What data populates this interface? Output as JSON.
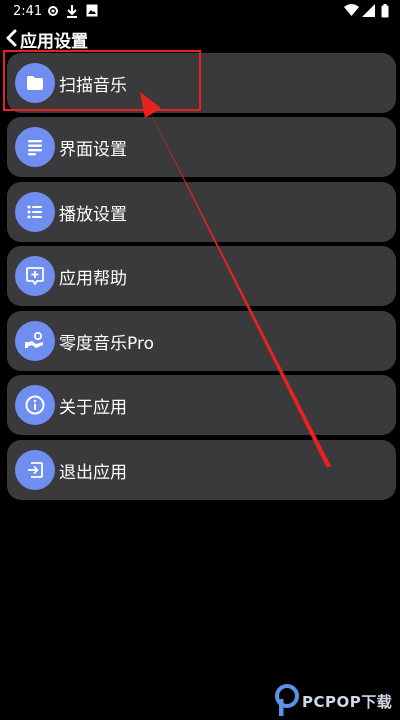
{
  "status_bar": {
    "time": "2:41",
    "icons": [
      "gear-icon",
      "download-icon",
      "image-icon",
      "wifi-icon",
      "signal-icon",
      "battery-icon"
    ]
  },
  "header": {
    "back_icon": "chevron-left-icon",
    "title": "应用设置"
  },
  "menu": {
    "items": [
      {
        "label": "扫描音乐",
        "icon": "folder-icon"
      },
      {
        "label": "界面设置",
        "icon": "document-lines-icon"
      },
      {
        "label": "播放设置",
        "icon": "list-icon"
      },
      {
        "label": "应用帮助",
        "icon": "help-chat-icon"
      },
      {
        "label": "零度音乐Pro",
        "icon": "pro-icon"
      },
      {
        "label": "关于应用",
        "icon": "info-icon"
      },
      {
        "label": "退出应用",
        "icon": "exit-icon"
      }
    ]
  },
  "annotation": {
    "color": "#e8231e"
  },
  "watermark": {
    "text": "PCPOP下载"
  },
  "colors": {
    "background": "#000000",
    "item_background": "#3a3a3c",
    "icon_circle": "#6f8ef0"
  }
}
